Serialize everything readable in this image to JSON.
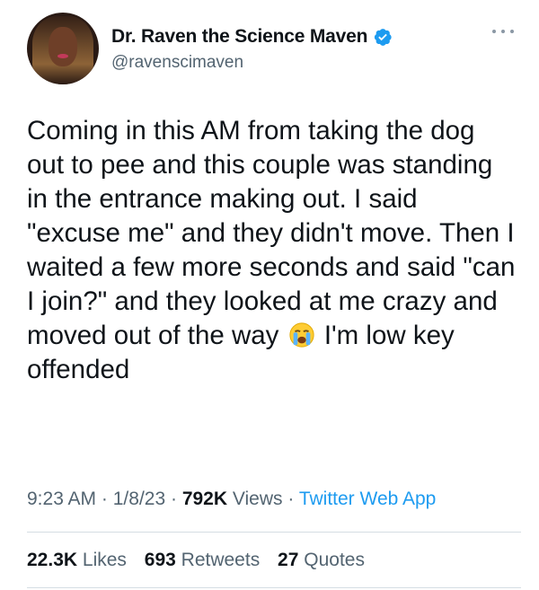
{
  "author": {
    "display_name": "Dr. Raven the Science Maven",
    "handle": "@ravenscimaven",
    "verified": true,
    "verified_color": "#1d9bf0",
    "avatar_icon": "profile-photo"
  },
  "tweet": {
    "text_parts": {
      "before_emoji": "Coming in this AM from taking the dog out to pee and this couple was standing in the entrance making out. I said \"excuse me\" and they didn't move. Then I waited a few more seconds and said \"can I join?\" and they looked at me crazy and moved out of the way",
      "emoji": "loudly-crying-face",
      "after_emoji": "I'm low key offended"
    }
  },
  "meta": {
    "time": "9:23 AM",
    "date": "1/8/23",
    "views_count": "792K",
    "views_label": "Views",
    "separator": "·",
    "source": "Twitter Web App"
  },
  "stats": {
    "likes_count": "22.3K",
    "likes_label": "Likes",
    "retweets_count": "693",
    "retweets_label": "Retweets",
    "quotes_count": "27",
    "quotes_label": "Quotes"
  },
  "colors": {
    "text_primary": "#0f1419",
    "text_secondary": "#536471",
    "link": "#1d9bf0",
    "divider": "#d5dde3"
  }
}
